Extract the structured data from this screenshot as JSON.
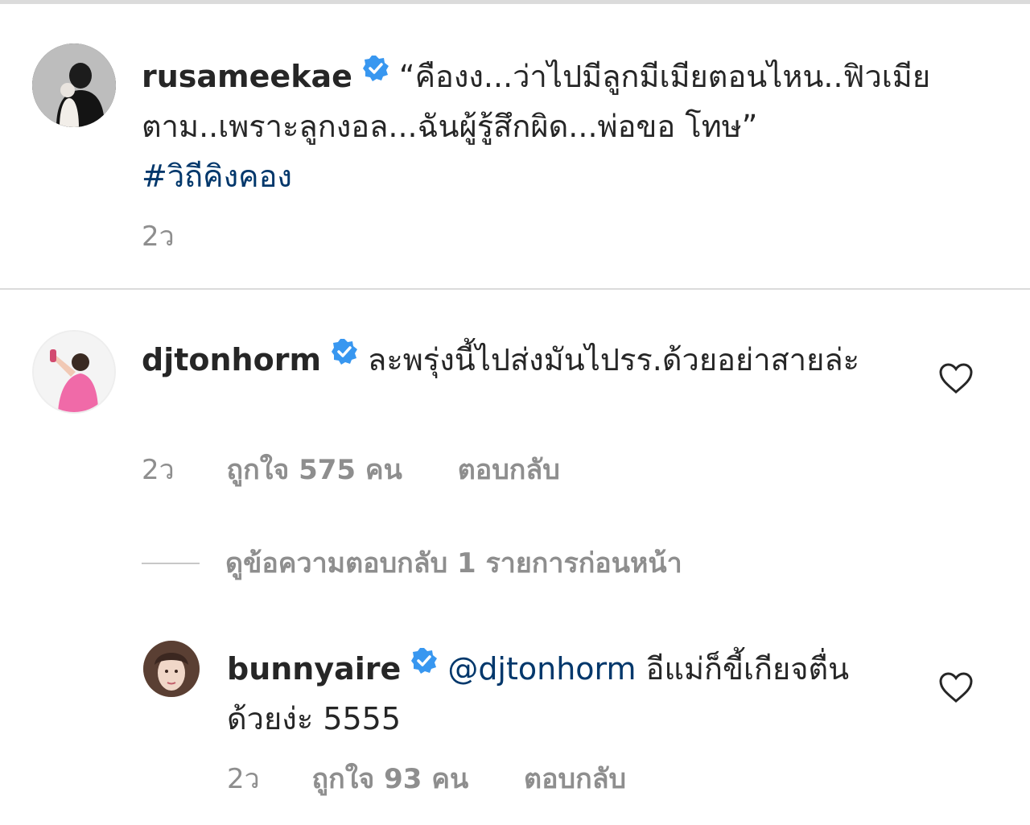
{
  "post": {
    "username": "rusameekae",
    "caption": "“คืองง...ว่าไปมีลูกมีเมียตอนไหน..ฟิวเมียตาม..เพราะลูกงอล...ฉันผู้รู้สึกผิด...พ่อขอ โทษ”",
    "hashtag": "#วิถีคิงคอง",
    "time": "2ว"
  },
  "comments": [
    {
      "username": "djtonhorm",
      "text": "ละพรุ่งนี้ไปส่งมันไปรร.ด้วยอย่าสายล่ะ",
      "time": "2ว",
      "likes": "ถูกใจ 575 คน",
      "reply_label": "ตอบกลับ"
    }
  ],
  "view_replies_label": "ดูข้อความตอบกลับ 1 รายการก่อนหน้า",
  "replies": [
    {
      "username": "bunnyaire",
      "mention": "@djtonhorm",
      "text": "อีแม่ก็ขี้เกียจตื่นด้วยง่ะ 5555",
      "time": "2ว",
      "likes": "ถูกใจ 93 คน",
      "reply_label": "ตอบกลับ"
    }
  ],
  "colors": {
    "verified_badge": "#3897f0",
    "text_primary": "#262626",
    "text_secondary": "#8e8e8e",
    "link": "#00376b"
  }
}
